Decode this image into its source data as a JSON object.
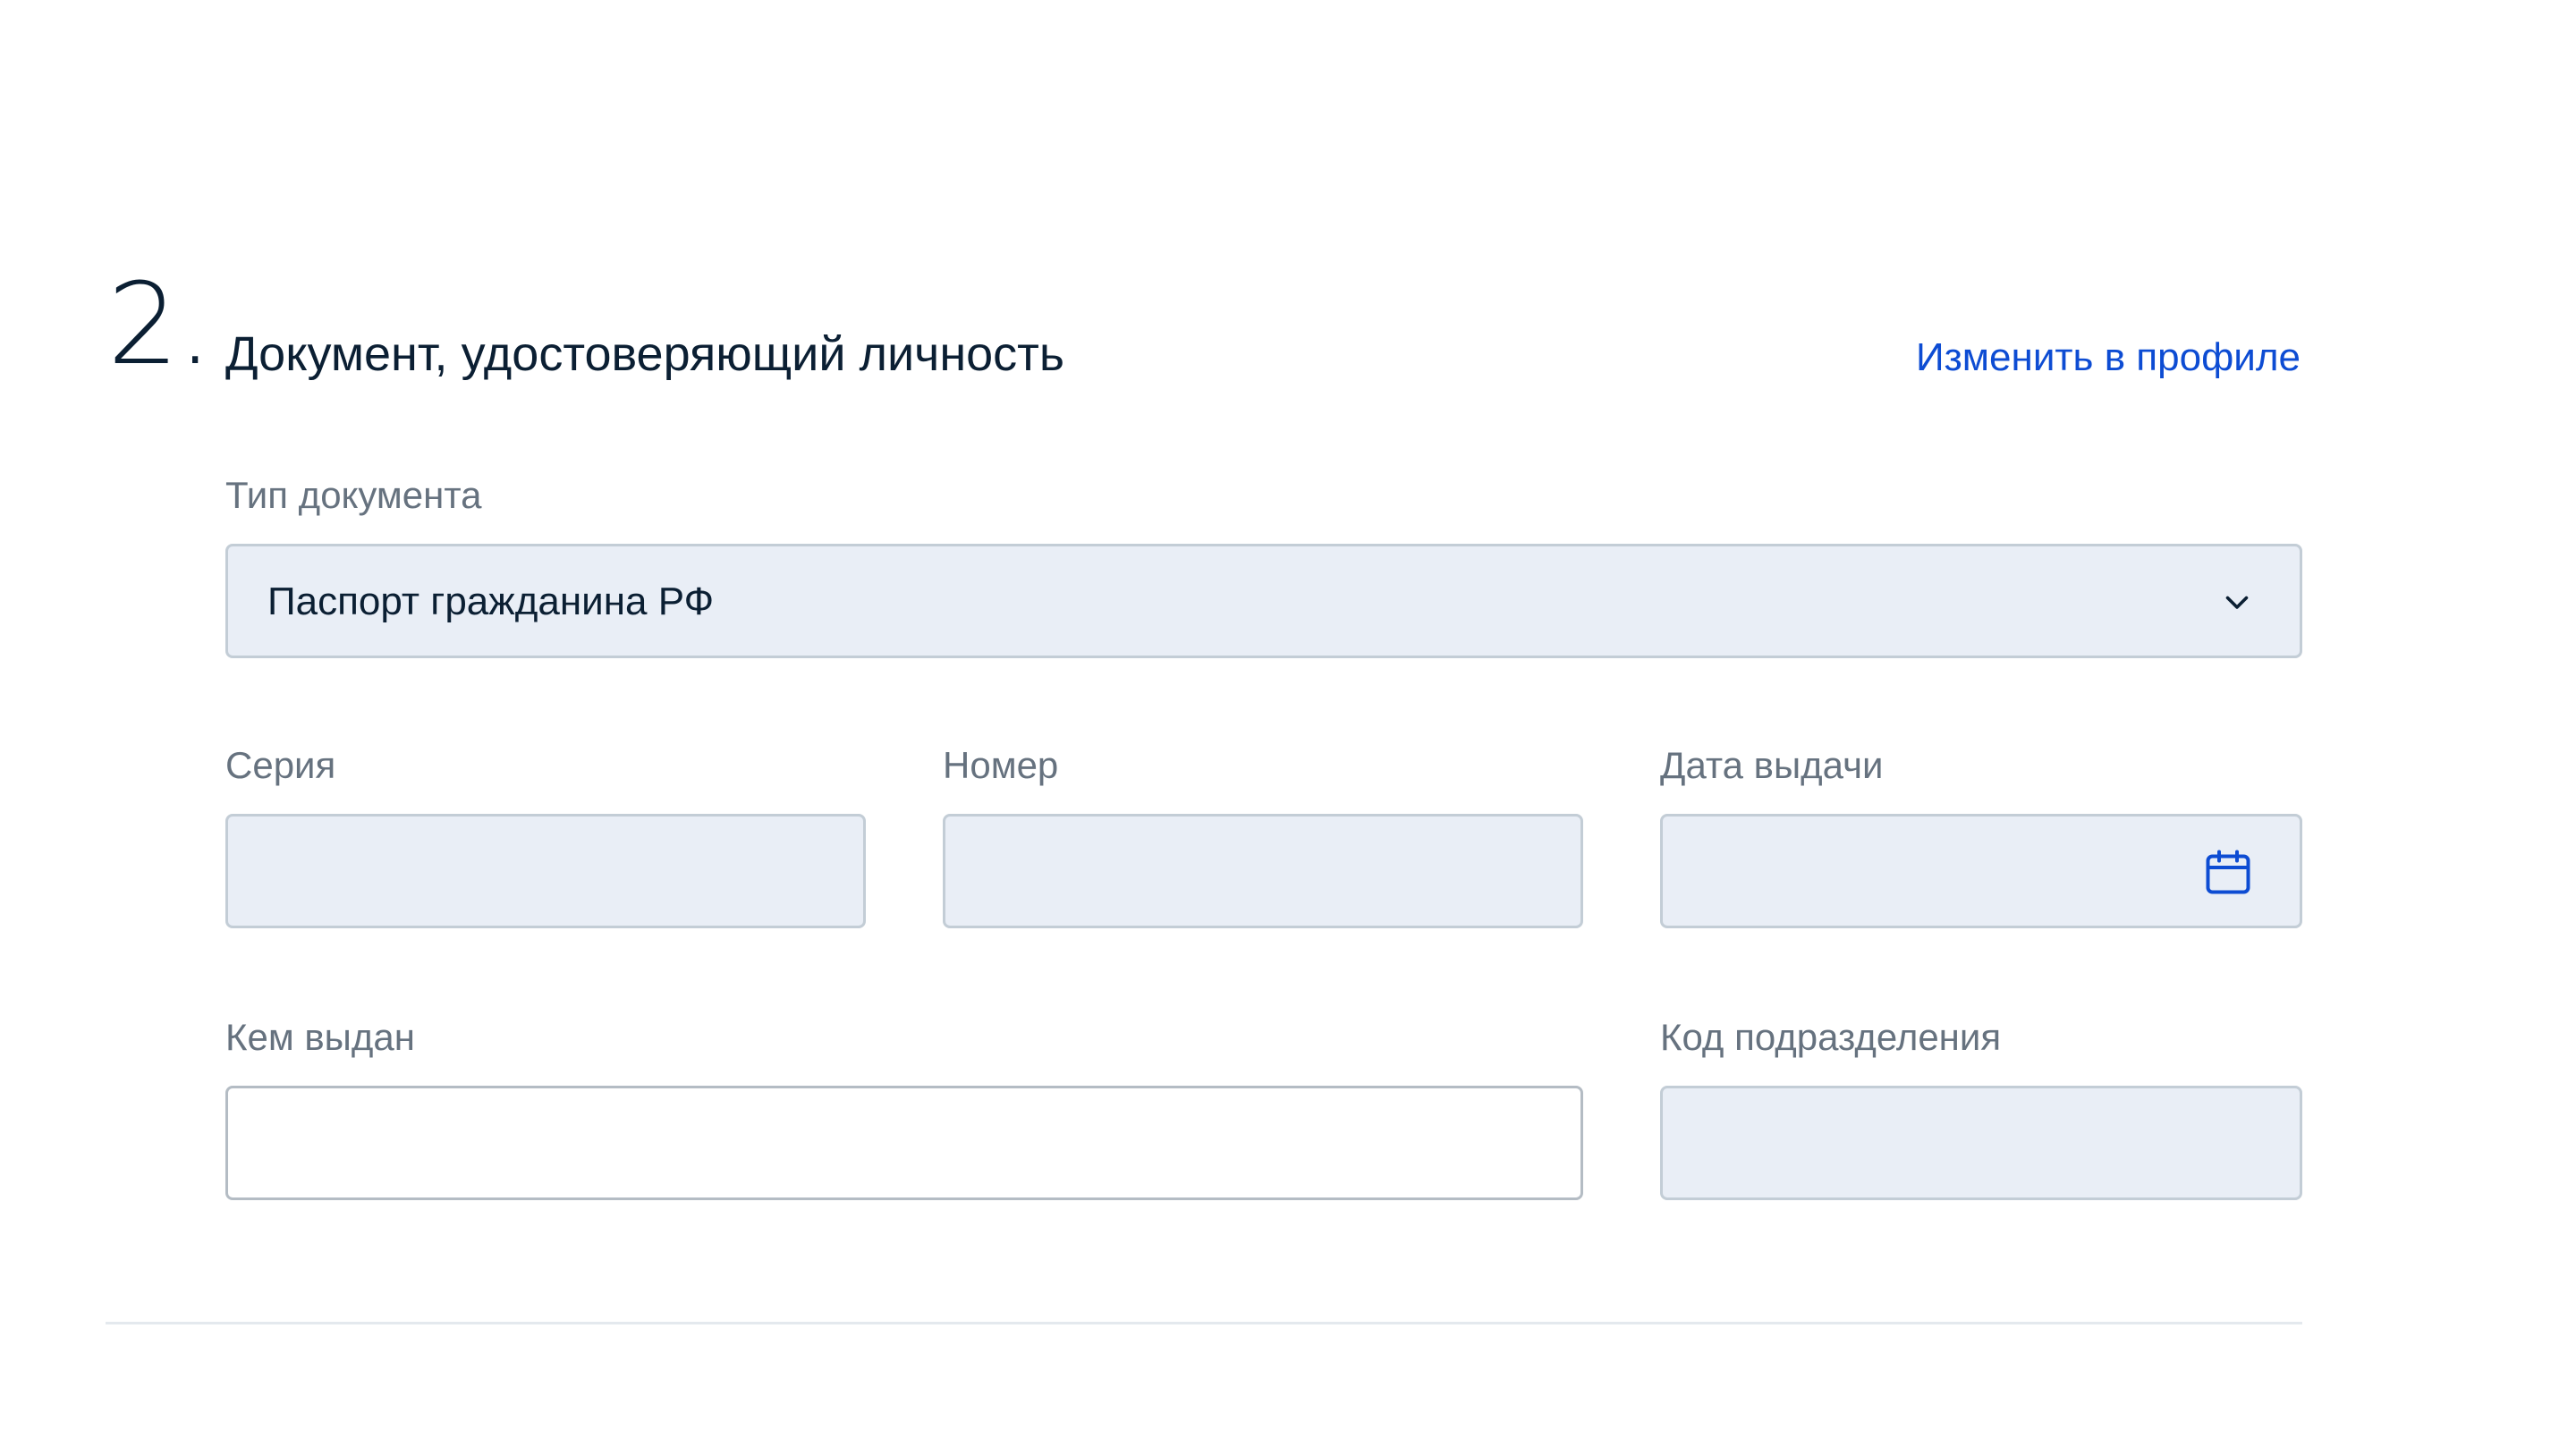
{
  "section": {
    "number": "2.",
    "title": "Документ, удостоверяющий личность",
    "edit_link": "Изменить в профиле"
  },
  "fields": {
    "doc_type": {
      "label": "Тип документа",
      "value": "Паспорт гражданина РФ",
      "icon": "chevron-down-icon"
    },
    "series": {
      "label": "Серия",
      "value": ""
    },
    "number": {
      "label": "Номер",
      "value": ""
    },
    "issue_date": {
      "label": "Дата выдачи",
      "value": "",
      "icon": "calendar-icon"
    },
    "issued_by": {
      "label": "Кем выдан",
      "value": ""
    },
    "subdivision_code": {
      "label": "Код подразделения",
      "value": ""
    }
  },
  "colors": {
    "link": "#0d4cd3",
    "field_background": "#e9eef6",
    "label": "#66727f",
    "text": "#0b1f33"
  }
}
